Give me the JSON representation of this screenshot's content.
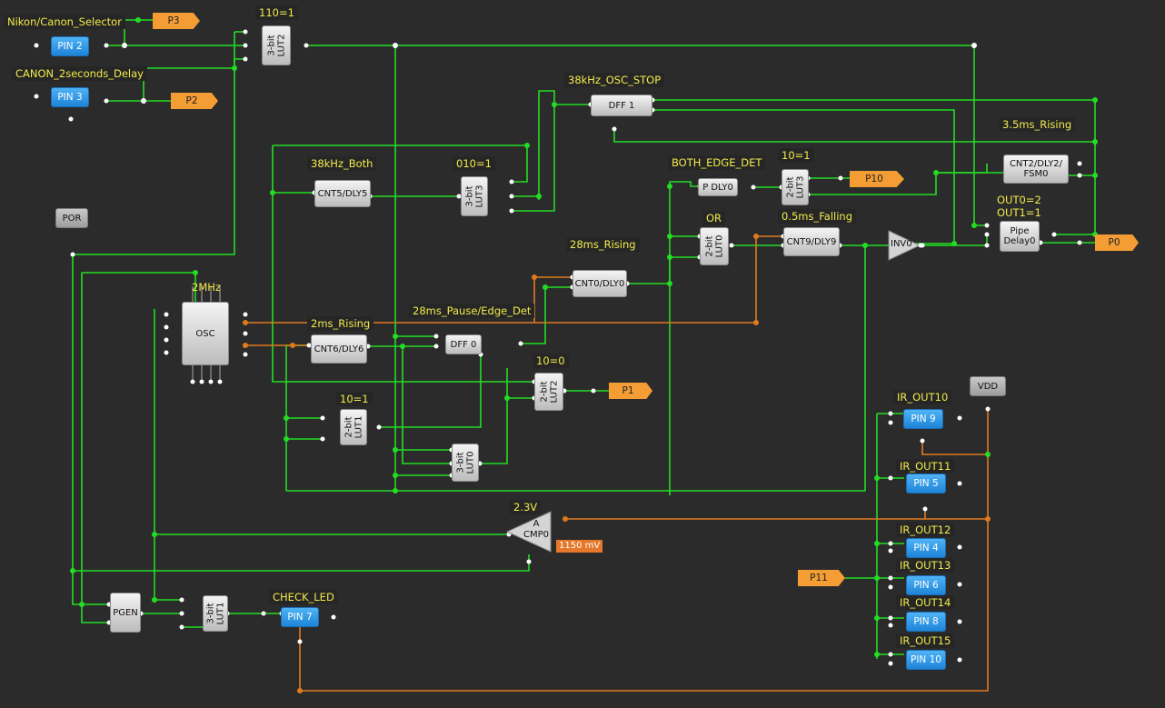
{
  "labels": {
    "nikon_canon_selector": "Nikon/Canon_Selector",
    "canon_2s_delay": "CANON_2seconds_Delay",
    "lut2_110": "110=1",
    "osc_38k_stop": "38kHz_OSC_STOP",
    "rising_3_5ms": "3.5ms_Rising",
    "both_38k": "38kHz_Both",
    "lut3_010": "010=1",
    "both_edge_det": "BOTH_EDGE_DET",
    "lut3_10": "10=1",
    "or_gate": "OR",
    "falling_0_5ms": "0.5ms_Falling",
    "out0_2": "OUT0=2",
    "out1_1": "OUT1=1",
    "rising_28ms": "28ms_Rising",
    "osc_2mhz": "2MHz",
    "rising_2ms": "2ms_Rising",
    "pause_28ms": "28ms_Pause/Edge_Det",
    "lut2_10_0": "10=0",
    "lut1_10_1": "10=1",
    "cmp_2_3v": "2.3V",
    "check_led": "CHECK_LED",
    "ir_out10": "IR_OUT10",
    "ir_out11": "IR_OUT11",
    "ir_out12": "IR_OUT12",
    "ir_out13": "IR_OUT13",
    "ir_out14": "IR_OUT14",
    "ir_out15": "IR_OUT15"
  },
  "blocks": {
    "lut2_3bit": "3-bit\nLUT2",
    "dff1": "DFF 1",
    "cnt5": "CNT5/DLY5",
    "lut3_3bit": "3-bit\nLUT3",
    "pdly0": "P DLY0",
    "lut3_2bit": "2-bit\nLUT3",
    "cnt2": "CNT2/DLY2/\nFSM0",
    "lut0_2bit": "2-bit\nLUT0",
    "cnt9": "CNT9/DLY9",
    "inv0": "INV0",
    "pipe": "Pipe\nDelay0",
    "cnt0": "CNT0/DLY0",
    "osc": "OSC",
    "cnt6": "CNT6/DLY6",
    "dff0": "DFF 0",
    "lut2_2bit": "2-bit\nLUT2",
    "lut1_2bit": "2-bit\nLUT1",
    "lut0_3bit": "3-bit\nLUT0",
    "cmp0": "A\nCMP0",
    "pgen": "PGEN",
    "lut1_3bit": "3-bit\nLUT1",
    "por": "POR",
    "vdd": "VDD"
  },
  "pins": {
    "pin2": "PIN 2",
    "pin3": "PIN 3",
    "pin7": "PIN 7",
    "pin9": "PIN 9",
    "pin5": "PIN 5",
    "pin4": "PIN 4",
    "pin6": "PIN 6",
    "pin8": "PIN 8",
    "pin10": "PIN 10"
  },
  "ports": {
    "p3": "P3",
    "p2": "P2",
    "p10": "P10",
    "p0": "P0",
    "p1": "P1",
    "p11": "P11"
  },
  "cmp_ref": "1150 mV",
  "colors": {
    "background": "#2b2b2b",
    "wire_green": "#22dd22",
    "wire_orange": "#e07a1f",
    "label_yellow": "#f2ea4a",
    "pin_blue": "#2b95e8",
    "port_orange": "#f49d35"
  }
}
